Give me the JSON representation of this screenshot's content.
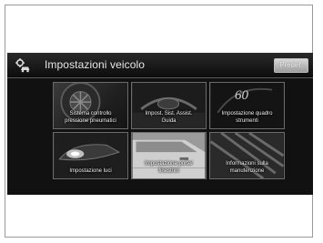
{
  "header": {
    "title": "Impostazioni veicolo",
    "default_button": "Predef.",
    "icon": "gear-car-icon"
  },
  "tiles": [
    {
      "label": "Sistema controllo\npressione pneumatici",
      "icon": "tire-icon"
    },
    {
      "label": "Impost. Sist. Assist.\nGuida",
      "icon": "steering-wheel-icon"
    },
    {
      "label": "Impostazione quadro\nstrumenti",
      "icon": "gauge-icon",
      "value": "60"
    },
    {
      "label": "Impostazione luci",
      "icon": "headlight-icon"
    },
    {
      "label": "Impostazione porte/\nfinestrini",
      "icon": "door-icon"
    },
    {
      "label": "Informazioni sulla\nmanutenzione",
      "icon": "engine-icon"
    }
  ]
}
